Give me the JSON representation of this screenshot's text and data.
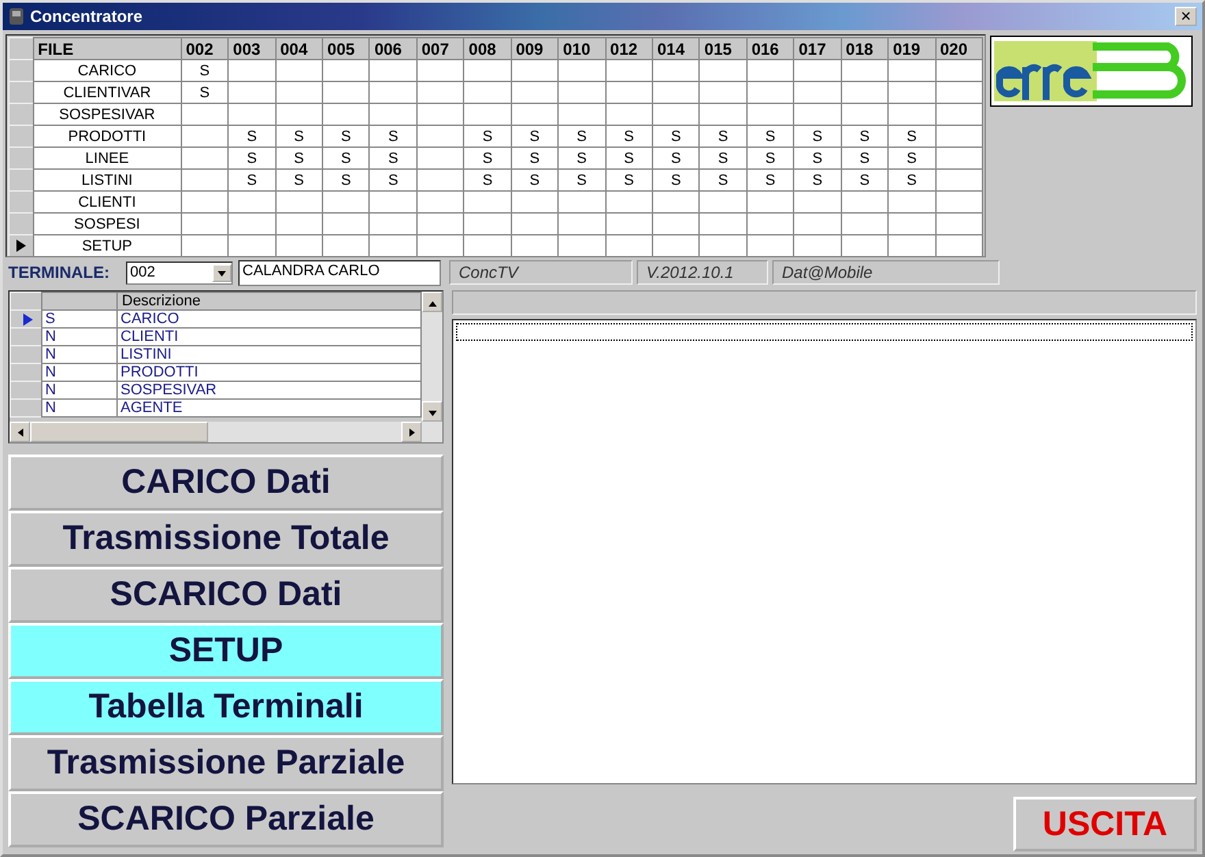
{
  "window": {
    "title": "Concentratore",
    "close": "×"
  },
  "file_grid": {
    "columns": [
      "FILE",
      "002",
      "003",
      "004",
      "005",
      "006",
      "007",
      "008",
      "009",
      "010",
      "012",
      "014",
      "015",
      "016",
      "017",
      "018",
      "019",
      "020"
    ],
    "rows": [
      {
        "current": false,
        "cells": [
          "CARICO",
          "S",
          "",
          "",
          "",
          "",
          "",
          "",
          "",
          "",
          "",
          "",
          "",
          "",
          "",
          "",
          "",
          ""
        ]
      },
      {
        "current": false,
        "cells": [
          "CLIENTIVAR",
          "S",
          "",
          "",
          "",
          "",
          "",
          "",
          "",
          "",
          "",
          "",
          "",
          "",
          "",
          "",
          "",
          ""
        ]
      },
      {
        "current": false,
        "cells": [
          "SOSPESIVAR",
          "",
          "",
          "",
          "",
          "",
          "",
          "",
          "",
          "",
          "",
          "",
          "",
          "",
          "",
          "",
          "",
          ""
        ]
      },
      {
        "current": false,
        "cells": [
          "PRODOTTI",
          "",
          "S",
          "S",
          "S",
          "S",
          "",
          "S",
          "S",
          "S",
          "S",
          "S",
          "S",
          "S",
          "S",
          "S",
          "S",
          ""
        ]
      },
      {
        "current": false,
        "cells": [
          "LINEE",
          "",
          "S",
          "S",
          "S",
          "S",
          "",
          "S",
          "S",
          "S",
          "S",
          "S",
          "S",
          "S",
          "S",
          "S",
          "S",
          ""
        ]
      },
      {
        "current": false,
        "cells": [
          "LISTINI",
          "",
          "S",
          "S",
          "S",
          "S",
          "",
          "S",
          "S",
          "S",
          "S",
          "S",
          "S",
          "S",
          "S",
          "S",
          "S",
          ""
        ]
      },
      {
        "current": false,
        "cells": [
          "CLIENTI",
          "",
          "",
          "",
          "",
          "",
          "",
          "",
          "",
          "",
          "",
          "",
          "",
          "",
          "",
          "",
          "",
          ""
        ]
      },
      {
        "current": false,
        "cells": [
          "SOSPESI",
          "",
          "",
          "",
          "",
          "",
          "",
          "",
          "",
          "",
          "",
          "",
          "",
          "",
          "",
          "",
          "",
          ""
        ]
      },
      {
        "current": true,
        "cells": [
          "SETUP",
          "",
          "",
          "",
          "",
          "",
          "",
          "",
          "",
          "",
          "",
          "",
          "",
          "",
          "",
          "",
          "",
          ""
        ]
      }
    ]
  },
  "terminal": {
    "label": "TERMINALE:",
    "value": "002",
    "name": "CALANDRA CARLO"
  },
  "status_panels": [
    "ConcTV",
    "V.2012.10.1",
    "Dat@Mobile"
  ],
  "detail_grid": {
    "column": "Descrizione",
    "rows": [
      {
        "flag": "S",
        "description": "CARICO",
        "current": true
      },
      {
        "flag": "N",
        "description": "CLIENTI",
        "current": false
      },
      {
        "flag": "N",
        "description": "LISTINI",
        "current": false
      },
      {
        "flag": "N",
        "description": "PRODOTTI",
        "current": false
      },
      {
        "flag": "N",
        "description": "SOSPESIVAR",
        "current": false
      },
      {
        "flag": "N",
        "description": "AGENTE",
        "current": false
      }
    ]
  },
  "buttons": [
    {
      "label": "CARICO Dati",
      "highlighted": false
    },
    {
      "label": "Trasmissione Totale",
      "highlighted": false
    },
    {
      "label": "SCARICO Dati",
      "highlighted": false
    },
    {
      "label": "SETUP",
      "highlighted": true
    },
    {
      "label": "Tabella Terminali",
      "highlighted": true
    },
    {
      "label": "Trasmissione Parziale",
      "highlighted": false
    },
    {
      "label": "SCARICO Parziale",
      "highlighted": false
    }
  ],
  "exit_button": {
    "label": "USCITA"
  }
}
